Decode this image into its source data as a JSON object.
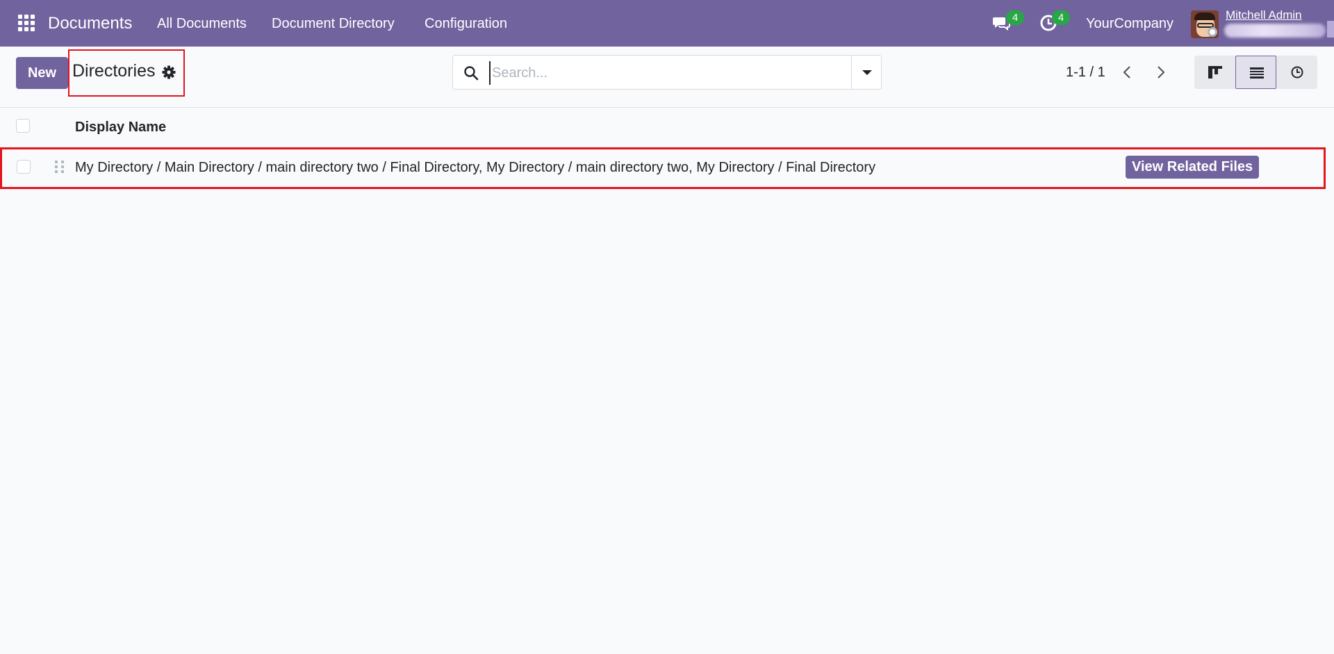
{
  "app": {
    "name": "Documents",
    "menu": [
      "All Documents",
      "Document Directory",
      "Configuration"
    ]
  },
  "systray": {
    "messages_count": "4",
    "activities_count": "4",
    "company": "YourCompany",
    "user_name": "Mitchell Admin"
  },
  "control_panel": {
    "new_label": "New",
    "breadcrumb": "Directories",
    "search_placeholder": "Search...",
    "pager": "1-1 / 1",
    "views": [
      "kanban",
      "list",
      "activity"
    ],
    "active_view": "list"
  },
  "list": {
    "columns": [
      "Display Name"
    ],
    "rows": [
      {
        "display_name": "My Directory / Main Directory / main directory two / Final Directory, My Directory / main directory two, My Directory / Final Directory",
        "action_label": "View Related Files"
      }
    ]
  },
  "colors": {
    "brand": "#71639e",
    "badge": "#28a745",
    "highlight": "#e5131d"
  }
}
